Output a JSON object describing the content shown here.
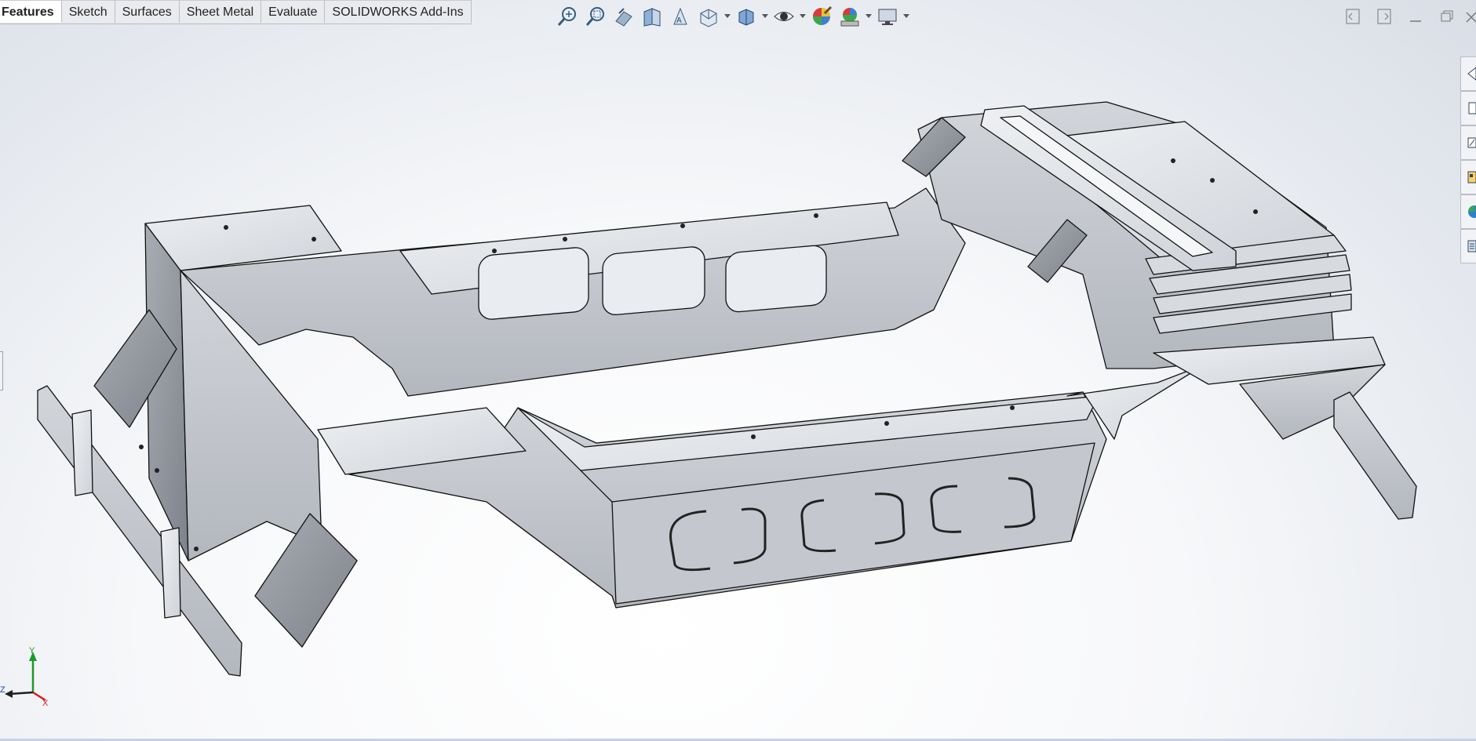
{
  "command_manager": {
    "tabs": [
      {
        "label": "Features",
        "active": true
      },
      {
        "label": "Sketch",
        "active": false
      },
      {
        "label": "Surfaces",
        "active": false
      },
      {
        "label": "Sheet Metal",
        "active": false
      },
      {
        "label": "Evaluate",
        "active": false
      },
      {
        "label": "SOLIDWORKS Add-Ins",
        "active": false
      }
    ]
  },
  "heads_up_toolbar": {
    "icons": [
      "zoom-to-fit-icon",
      "zoom-to-area-icon",
      "previous-view-icon",
      "section-view-icon",
      "dynamic-annotation-view-icon",
      "view-orientation-icon",
      "display-style-icon",
      "hide-show-items-icon",
      "edit-appearance-icon",
      "apply-scene-icon",
      "view-settings-icon"
    ]
  },
  "window_controls": [
    "tile-left-icon",
    "tile-right-icon",
    "minimize-icon",
    "restore-icon",
    "close-icon"
  ],
  "task_pane": {
    "icons": [
      "solidworks-resources-icon",
      "design-library-icon",
      "file-explorer-icon",
      "view-palette-icon",
      "appearances-icon",
      "custom-properties-icon"
    ]
  },
  "triad": {
    "x": "X",
    "y": "Y",
    "z": "Z"
  },
  "colors": {
    "viewport_top": "#d9dee6",
    "viewport_bottom": "#ffffff",
    "part_face": "#c9ccd2",
    "part_edge": "#111111",
    "axis_x": "#d62020",
    "axis_y": "#1a9a2a",
    "axis_z": "#1f3fbf"
  }
}
